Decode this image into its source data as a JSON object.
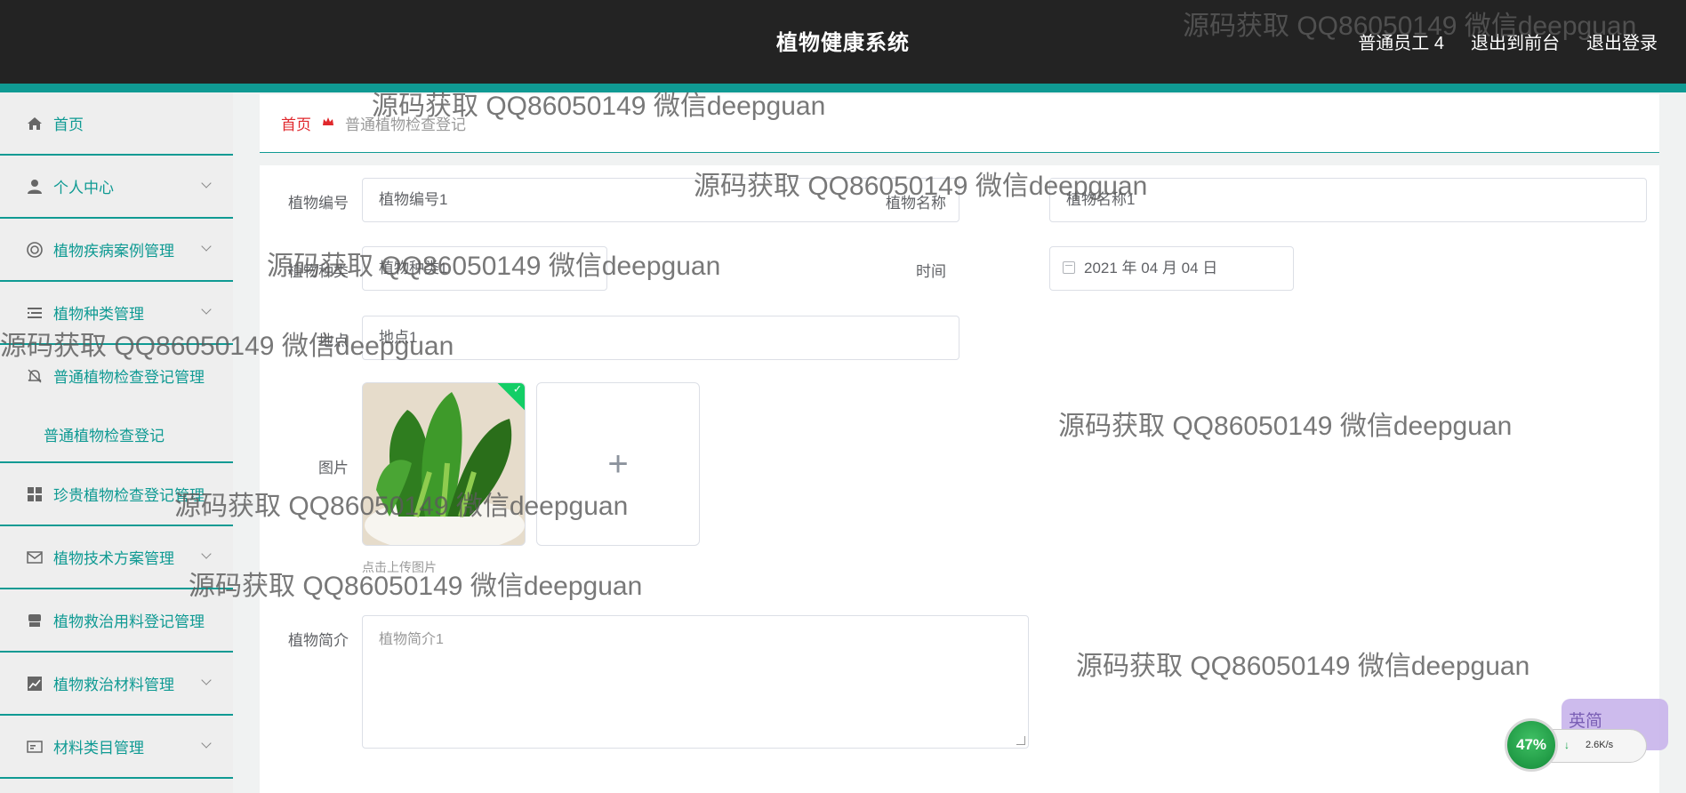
{
  "header": {
    "title": "植物健康系统",
    "user_label": "普通员工 4",
    "to_front_label": "退出到前台",
    "logout_label": "退出登录"
  },
  "sidebar": {
    "items": [
      {
        "label": "首页",
        "icon": "home-icon",
        "expandable": false
      },
      {
        "label": "个人中心",
        "icon": "user-icon",
        "expandable": true
      },
      {
        "label": "植物疾病案例管理",
        "icon": "lifebuoy-icon",
        "expandable": true
      },
      {
        "label": "植物种类管理",
        "icon": "list-icon",
        "expandable": true
      },
      {
        "label": "普通植物检查登记管理",
        "icon": "bell-off-icon",
        "expandable": false,
        "open": true,
        "children": [
          "普通植物检查登记"
        ]
      },
      {
        "label": "珍贵植物检查登记管理",
        "icon": "grid-icon",
        "expandable": false
      },
      {
        "label": "植物技术方案管理",
        "icon": "mail-icon",
        "expandable": true
      },
      {
        "label": "植物救治用料登记管理",
        "icon": "store-icon",
        "expandable": false
      },
      {
        "label": "植物救治材料管理",
        "icon": "chart-icon",
        "expandable": true
      },
      {
        "label": "材料类目管理",
        "icon": "card-icon",
        "expandable": true
      }
    ]
  },
  "breadcrumb": {
    "home": "首页",
    "separator_icon": "crown-icon",
    "current": "普通植物检查登记"
  },
  "form": {
    "plant_code_label": "植物编号",
    "plant_code_value": "植物编号1",
    "plant_name_label": "植物名称",
    "plant_name_value": "植物名称1",
    "plant_type_label": "植物种类",
    "plant_type_value": "植物种类1",
    "time_label": "时间",
    "time_value": "2021 年 04 月 04 日",
    "place_label": "地点",
    "place_value": "地点1",
    "image_label": "图片",
    "upload_tip": "点击上传图片",
    "upload_plus": "+",
    "intro_label": "植物简介",
    "intro_value": "植物简介1"
  },
  "watermark": "源码获取 QQ86050149 微信deepguan",
  "widget": {
    "percent": "47%",
    "speed": "2.6K/s",
    "ime": "英简"
  },
  "colors": {
    "accent": "#0f9a93",
    "header_bg": "#232323",
    "breadcrumb_home": "#e0282c"
  }
}
